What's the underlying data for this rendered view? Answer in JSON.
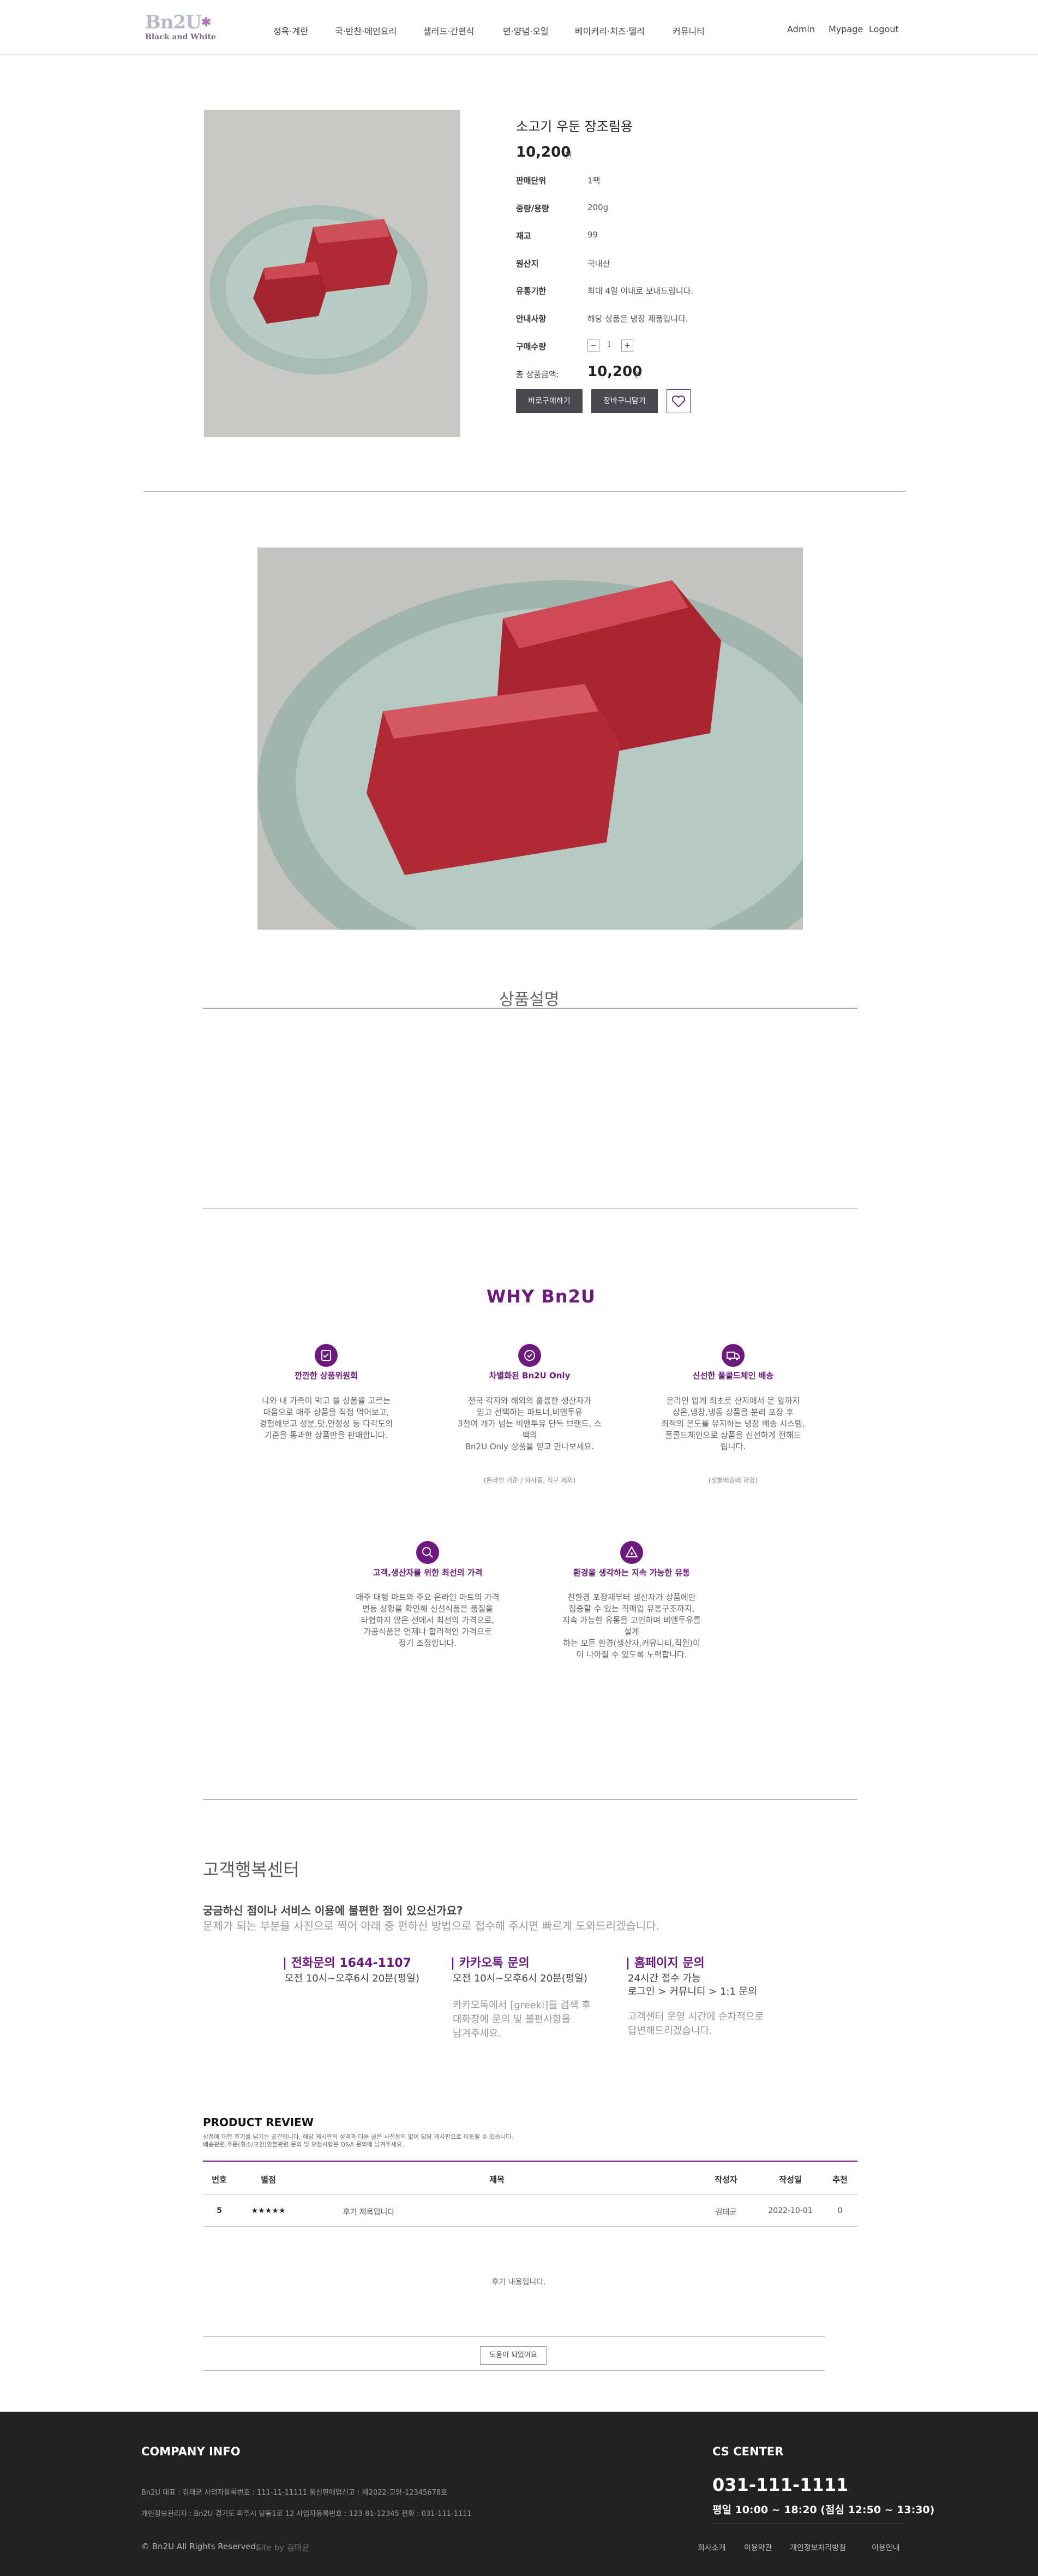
{
  "header": {
    "logo_main": "Bn2U",
    "logo_sub": "Black and White",
    "nav": [
      "정육·계란",
      "국·반찬·메인요리",
      "샐러드·간편식",
      "면·양념·오일",
      "베이커리·치즈·델리",
      "커뮤니티"
    ],
    "util": [
      "Admin",
      "Mypage",
      "Logout"
    ]
  },
  "product": {
    "name": "소고기 우둔 장조림용",
    "price": "10,200",
    "price_unit": "원",
    "info": [
      {
        "label": "판매단위",
        "value": "1팩"
      },
      {
        "label": "중량/용량",
        "value": "200g"
      },
      {
        "label": "재고",
        "value": "99"
      },
      {
        "label": "원산지",
        "value": "국내산"
      },
      {
        "label": "유통기한",
        "value": "최대 4일 이내로 보내드립니다."
      },
      {
        "label": "안내사항",
        "value": "해당 상품은 냉장 제품입니다."
      }
    ],
    "qty_label": "구매수량",
    "qty_minus": "−",
    "qty_value": "1",
    "qty_plus": "+",
    "total_label": "총 상품금액:",
    "total_value": "10,200",
    "total_unit": "원",
    "buy_label": "바로구매하기",
    "cart_label": "장바구니담기"
  },
  "description": {
    "title": "상품설명"
  },
  "why": {
    "title": "WHY Bn2U",
    "features": [
      {
        "title": "깐깐한 상품위원회",
        "desc": [
          "나와 내 가족이 먹고 쓸 상품을 고르는",
          "마음으로 매주 상품을 직접 먹어보고,",
          "경험해보고 성분,맛,안정성 등 다각도의",
          "기준을 통과한 상품만을 판매합니다."
        ],
        "note": "",
        "icon": "check-icon"
      },
      {
        "title": "차별화된 Bn2U Only",
        "desc": [
          "전국 각지와 해외의 훌륭한 생산자가",
          "믿고 선택하는 파트너,비앤투유",
          "3천여 개가 넘는 비앤투유 단독 브랜드, 스",
          "펙의",
          "Bn2U Only 상품을 믿고 만나보세요."
        ],
        "note": "(온라인 기준 / 자사몰, 직구 제외)",
        "icon": "badge-icon"
      },
      {
        "title": "신선한 풀콜드체인 배송",
        "desc": [
          "온라인 업계 최초로 산지에서 문 앞까지",
          "상온,냉장,냉동 상품을 분리 포장 후",
          "최적의 온도를 유지하는 냉장 배송 시스템,",
          "풀콜드체인으로 상품을 신선하게 전해드",
          "립니다."
        ],
        "note": "(샛별배송에 한함)",
        "icon": "truck-icon"
      },
      {
        "title": "고객,생산자를 위한 최선의 가격",
        "desc": [
          "매주 대형 마트와 주요 온라인 마트의 가격",
          "변동 상황을 확인해 신선식품은 품질을",
          "타협하지 않은 선에서 최선의 가격으로,",
          "가공식품은 언제나 합리적인 가격으로",
          "정기 조정합니다."
        ],
        "note": "",
        "icon": "search-price-icon"
      },
      {
        "title": "환경을 생각하는 지속 가능한 유통",
        "desc": [
          "친환경 포장재부터 생산자가 상품에만",
          "집중할 수 있는 직매입 유통구조까지,",
          "지속 가능한 유통을 고민하며 비앤투유를",
          "설계",
          "하는 모든 환경(생산자,커뮤니티,직원)이",
          "이 나아질 수 있도록 노력합니다."
        ],
        "note": "",
        "icon": "leaf-icon"
      }
    ]
  },
  "cs": {
    "title": "고객행복센터",
    "question": "궁금하신 점이나 서비스 이용에 불편한 점이 있으신가요?",
    "guide": "문제가 되는 부분을 사진으로 찍어 아래 중 편하신 방법으로 접수해 주시면 빠르게 도와드리겠습니다.",
    "channels": [
      {
        "title": "| 전화문의 1644-1107",
        "lines": [
          "오전 10시~오후6시 20분(평일)"
        ],
        "extra": []
      },
      {
        "title": "| 카카오톡 문의",
        "lines": [
          "오전 10시~오후6시 20분(평일)"
        ],
        "extra": [
          "카카오톡에서 [greeki]를 검색 후",
          "대화창에 문의 및 불편사항을",
          "남겨주세요."
        ]
      },
      {
        "title": "| 홈페이지 문의",
        "lines": [
          "24시간 접수 가능",
          "로그인 > 커뮤니티 > 1:1 문의"
        ],
        "extra": [
          "고객센터 운영 시간에 순차적으로",
          "답변해드리겠습니다."
        ]
      }
    ]
  },
  "review": {
    "title": "PRODUCT REVIEW",
    "desc1": "상품에 대한 후기를 남기는 공간입니다. 해당 게시판의 성격과 다른 글은 사전동의 없이 담당 게시판으로 이동될 수 있습니다.",
    "desc2": "배송관련,주문(취소/교환)환불관련 문의 및 요청사항은 Q&A 문의에 남겨주세요.",
    "columns": [
      "번호",
      "별점",
      "제목",
      "작성자",
      "작성일",
      "추천"
    ],
    "rows": [
      {
        "no": "5",
        "stars": "★★★★★",
        "title": "후기 제목입니다",
        "author": "김태균",
        "date": "2022-10-01",
        "likes": "0"
      }
    ],
    "content": "후기 내용입니다.",
    "more": "도움이 되었어요"
  },
  "footer": {
    "company_title": "COMPANY INFO",
    "info1": "Bn2U   대표 : 김태균   사업자등록번호 : 111-11-11111   통신판매업신고 : 제2022-고양-12345678호",
    "info2": "개인정보관리자 : Bn2U   경기도 파주시 당동1로 12   사업자등록번호 : 123-81-12345   전화 : 031-111-1111",
    "copyright": "© Bn2U All Rights Reserved.",
    "site_by": "Site by 김태균",
    "cs_title": "CS CENTER",
    "cs_phone": "031-111-1111",
    "cs_hours": "평일 10:00 ~ 18:20 (점심 12:50 ~ 13:30)",
    "links": [
      "회사소개",
      "이용약관",
      "개인정보처리방침",
      "이용안내"
    ]
  },
  "colors": {
    "accent": "#6d1a7e",
    "dark_button": "#4a4950",
    "footer_bg": "#222222"
  }
}
